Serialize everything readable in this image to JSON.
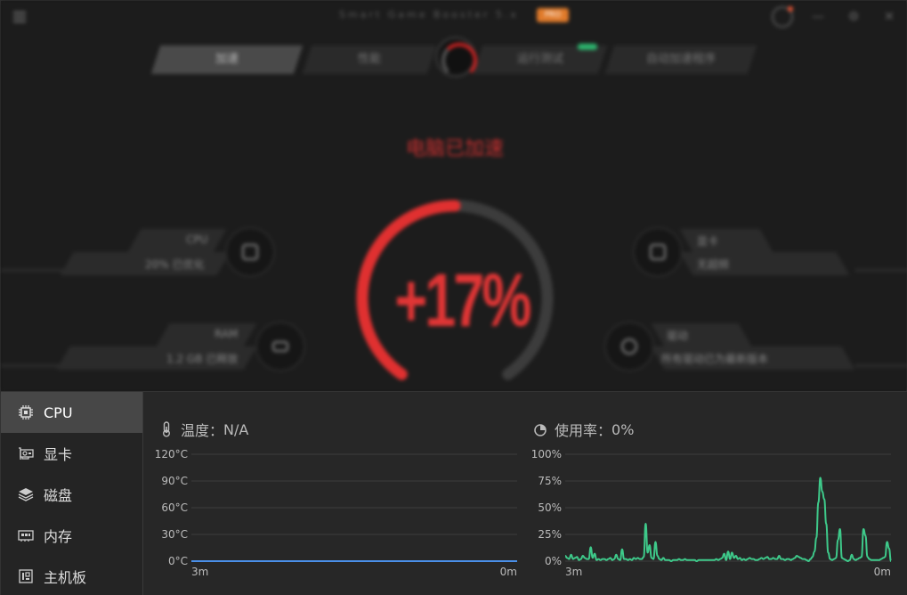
{
  "header": {
    "app_title": "Smart Game Booster 5.x",
    "badge": "PRO",
    "minimize": "—",
    "settings": "⚙",
    "close": "✕"
  },
  "tabs": [
    {
      "label": "加速"
    },
    {
      "label": "性能"
    },
    {
      "label": "运行测试"
    },
    {
      "label": "自动加速程序"
    }
  ],
  "boost": {
    "status": "电脑已加速",
    "percent": "+17%",
    "fraction": 0.17
  },
  "info": {
    "cpu": {
      "title": "CPU",
      "detail": "20% 已优化"
    },
    "ram": {
      "title": "RAM",
      "detail": "1.2 GB 已释放"
    },
    "gpu": {
      "title": "显卡",
      "detail": "无超频"
    },
    "driver": {
      "title": "驱动",
      "detail": "所有驱动已为最新版本"
    }
  },
  "sidebar": {
    "items": [
      {
        "label": "CPU",
        "icon": "cpu-chip-icon",
        "active": true
      },
      {
        "label": "显卡",
        "icon": "graphics-card-icon",
        "active": false
      },
      {
        "label": "磁盘",
        "icon": "disk-layers-icon",
        "active": false
      },
      {
        "label": "内存",
        "icon": "memory-icon",
        "active": false
      },
      {
        "label": "主机板",
        "icon": "motherboard-icon",
        "active": false
      }
    ]
  },
  "temperature": {
    "label": "温度：",
    "value": "N/A",
    "icon": "thermometer-icon"
  },
  "usage": {
    "label": "使用率：",
    "value": "0%",
    "icon": "pie-chart-icon"
  },
  "chart_data": [
    {
      "type": "line",
      "series": [
        {
          "values": [
            0,
            0,
            0,
            0,
            0,
            0,
            0,
            0,
            0,
            0,
            0,
            0,
            0,
            0,
            0,
            0,
            0,
            0,
            0,
            0,
            0,
            0,
            0,
            0,
            0,
            0,
            0,
            0,
            0,
            0,
            0,
            0,
            0,
            0,
            0,
            0,
            0,
            0,
            0,
            0,
            0,
            0,
            0,
            0,
            0,
            0,
            0,
            0,
            0,
            0,
            0,
            0,
            0,
            0,
            0,
            0,
            0,
            0,
            0,
            0,
            0
          ]
        }
      ],
      "x_start": "3m",
      "x_end": "0m",
      "yticks": [
        "120°C",
        "90°C",
        "60°C",
        "30°C",
        "0°C"
      ],
      "ylim": [
        0,
        120
      ],
      "color": "#4a8fe8",
      "grid": true
    },
    {
      "type": "line",
      "series": [
        {
          "values": [
            5,
            3,
            2,
            6,
            2,
            3,
            4,
            1,
            2,
            5,
            3,
            2,
            2,
            13,
            3,
            7,
            1,
            2,
            1,
            2,
            2,
            1,
            2,
            3,
            1,
            2,
            6,
            2,
            1,
            11,
            2,
            2,
            1,
            2,
            1,
            3,
            2,
            3,
            2,
            2,
            4,
            35,
            8,
            15,
            3,
            2,
            18,
            5,
            2,
            1,
            3,
            1,
            1,
            1,
            0,
            1,
            1,
            1,
            2,
            1,
            1,
            2,
            1,
            1,
            1,
            1,
            1,
            0,
            1,
            1,
            1,
            1,
            1,
            1,
            1,
            1,
            1,
            2,
            1,
            2,
            3,
            7,
            1,
            9,
            2,
            8,
            3,
            5,
            2,
            3,
            1,
            2,
            1,
            2,
            3,
            2,
            2,
            1,
            1,
            2,
            3,
            2,
            3,
            4,
            2,
            2,
            3,
            2,
            2,
            5,
            2,
            2,
            1,
            2,
            2,
            1,
            2,
            3,
            5,
            4,
            3,
            2,
            2,
            1,
            0,
            2,
            4,
            9,
            22,
            55,
            78,
            65,
            58,
            35,
            8,
            2,
            1,
            2,
            3,
            20,
            30,
            3,
            2,
            1,
            0,
            1,
            6,
            2,
            1,
            2,
            3,
            4,
            30,
            24,
            4,
            2,
            1,
            1,
            1,
            1,
            1,
            2,
            3,
            4,
            18,
            12,
            0
          ]
        }
      ],
      "x_start": "3m",
      "x_end": "0m",
      "yticks": [
        "100%",
        "75%",
        "50%",
        "25%",
        "0%"
      ],
      "ylim": [
        0,
        100
      ],
      "color": "#3ec98a",
      "grid": true
    }
  ]
}
